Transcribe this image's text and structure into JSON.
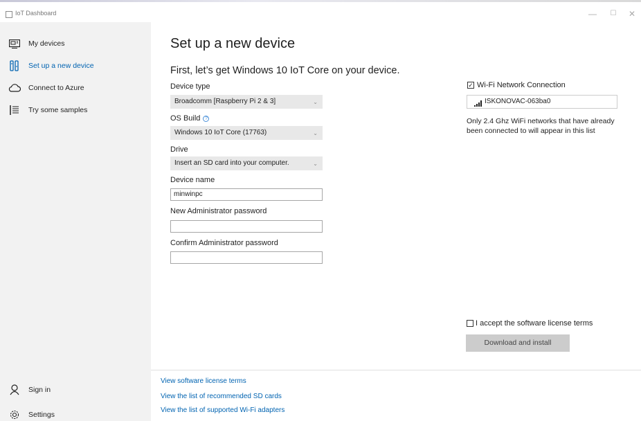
{
  "window": {
    "title": "IoT Dashboard",
    "minimize": "—",
    "maximize": "☐",
    "close": "✕"
  },
  "sidebar": {
    "items": [
      {
        "label": "My devices",
        "icon": "device-icon"
      },
      {
        "label": "Set up a new device",
        "icon": "setup-icon",
        "active": true
      },
      {
        "label": "Connect to Azure",
        "icon": "cloud-icon"
      },
      {
        "label": "Try some samples",
        "icon": "samples-icon"
      }
    ],
    "bottom": [
      {
        "label": "Sign in",
        "icon": "person-icon"
      },
      {
        "label": "Settings",
        "icon": "gear-icon"
      }
    ]
  },
  "main": {
    "title": "Set up a new device",
    "subtitle": "First, let’s get Windows 10 IoT Core on your device.",
    "device_type": {
      "label": "Device type",
      "value": "Broadcomm [Raspberry Pi 2 & 3]"
    },
    "os_build": {
      "label": "OS Build",
      "value": "Windows 10 IoT Core (17763)"
    },
    "drive": {
      "label": "Drive",
      "value": "Insert an SD card into your computer."
    },
    "device_name": {
      "label": "Device name",
      "value": "minwinpc"
    },
    "new_password": {
      "label": "New Administrator password",
      "value": ""
    },
    "confirm_password": {
      "label": "Confirm Administrator password",
      "value": ""
    },
    "wifi": {
      "checkbox_label": "Wi-Fi Network Connection",
      "checked": true,
      "network": "ISKONOVAC-063ba0",
      "note": "Only 2.4 Ghz WiFi networks that have already been connected to will appear in this list"
    },
    "license": {
      "label": "I accept the software license terms",
      "checked": false
    },
    "download_button": "Download and install",
    "links": [
      "View software license terms",
      "View the list of recommended SD cards",
      "View the list of supported Wi-Fi adapters"
    ]
  },
  "colors": {
    "accent": "#0063b1",
    "sidebar_bg": "#f2f2f2",
    "disabled_button": "#cccccc"
  }
}
